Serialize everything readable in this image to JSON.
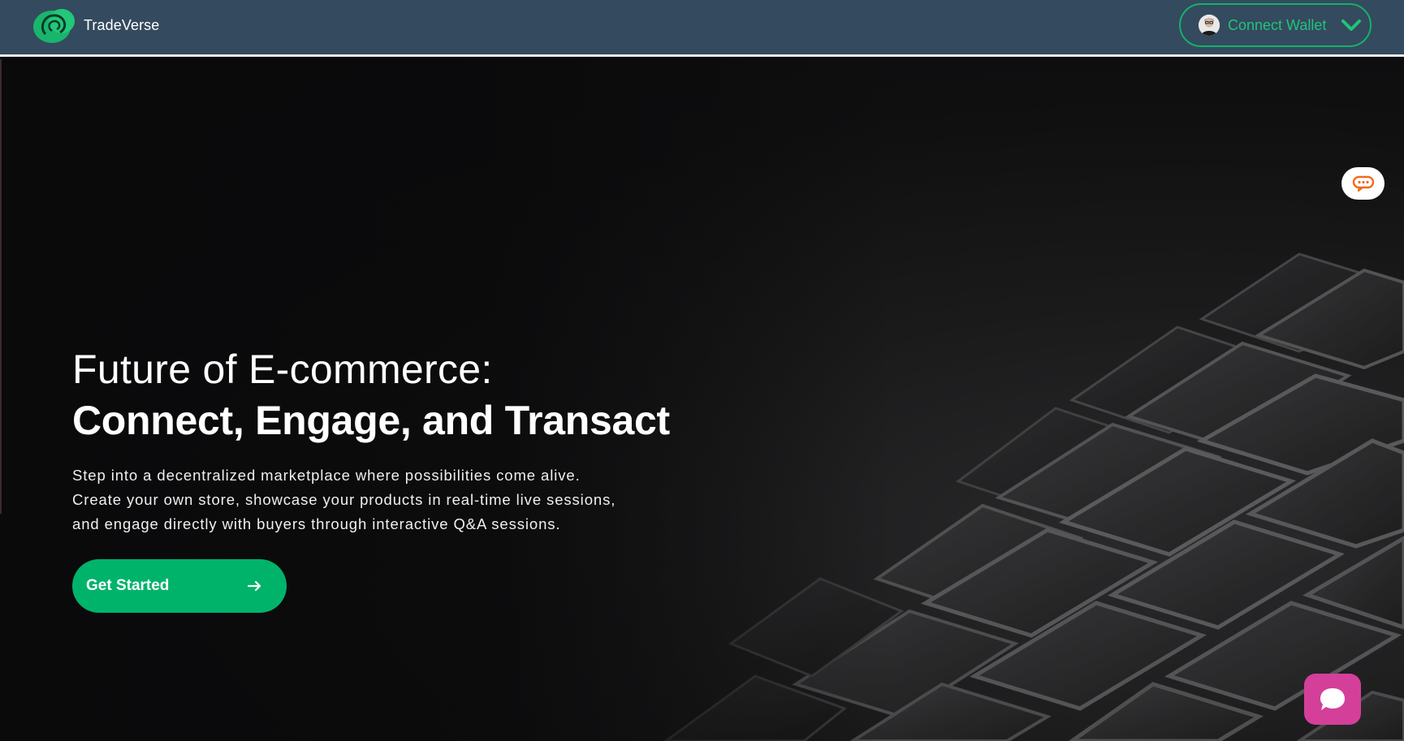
{
  "header": {
    "brand_name": "TradeVerse",
    "wallet_button_label": "Connect Wallet"
  },
  "hero": {
    "headline_line1": "Future of E-commerce:",
    "headline_line2": "Connect, Engage, and Transact",
    "description_lines": [
      "Step into a decentralized marketplace where possibilities come alive.",
      "Create your own store, showcase your products in real-time live sessions,",
      "and engage directly with buyers through interactive Q&A sessions."
    ],
    "cta_label": "Get Started"
  },
  "icons": {
    "logo": "tradeverse-logo-icon",
    "avatar": "user-avatar-icon",
    "dropdown": "chevron-down-icon",
    "cta_arrow": "arrow-right-icon",
    "assistant": "chat-assistant-icon",
    "chat": "chat-bubble-icon"
  },
  "colors": {
    "header_bg": "#344a5e",
    "accent_green": "#00b36b",
    "wallet_text": "#1fc47a",
    "chat_launcher": "#d43f9a",
    "assistant_icon": "#f26b1d"
  }
}
